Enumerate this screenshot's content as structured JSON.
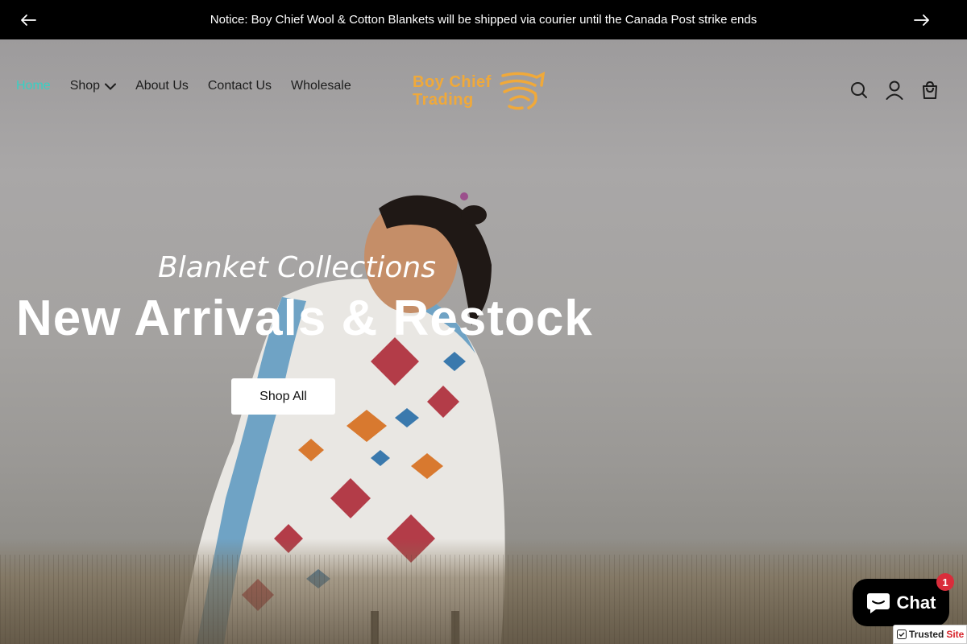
{
  "announcement": {
    "text": "Notice: Boy Chief Wool & Cotton Blankets will be shipped via courier until the Canada Post strike ends",
    "prev_icon": "arrow-left-icon",
    "next_icon": "arrow-right-icon"
  },
  "nav": {
    "items": [
      {
        "label": "Home",
        "active": true
      },
      {
        "label": "Shop",
        "has_dropdown": true
      },
      {
        "label": "About Us"
      },
      {
        "label": "Contact Us"
      },
      {
        "label": "Wholesale"
      }
    ]
  },
  "logo": {
    "line1": "Boy Chief",
    "line2": "Trading",
    "color": "#f0a93a"
  },
  "header_icons": [
    "search-icon",
    "account-icon",
    "cart-icon"
  ],
  "hero": {
    "subtitle": "Blanket Collections",
    "title": "New Arrivals & Restock",
    "button": "Shop All"
  },
  "chat": {
    "label": "Chat",
    "badge": "1"
  },
  "trusted": {
    "part1": "Trusted",
    "part2": "Site"
  },
  "colors": {
    "accent": "#36d1c4",
    "brand": "#f0a93a",
    "announce_bg": "#000000",
    "badge": "#d92d3b"
  }
}
